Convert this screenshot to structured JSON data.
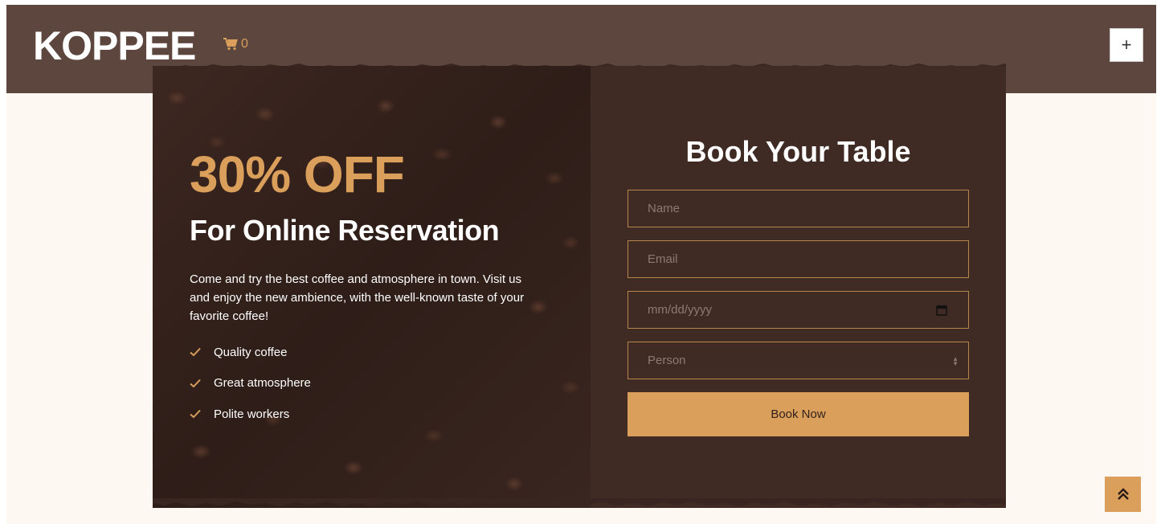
{
  "navbar": {
    "brand": "KOPPEE",
    "cart_count": "0",
    "cart_icon": "shopping-cart-icon",
    "toggler_label": "+"
  },
  "promo": {
    "title": "30% OFF",
    "subtitle": "For Online Reservation",
    "description": "Come and try the best coffee and atmosphere in town. Visit us and enjoy the new ambience, with the well-known taste of your favorite coffee!",
    "features": [
      {
        "label": "Quality coffee",
        "icon": "check-icon"
      },
      {
        "label": "Great atmosphere",
        "icon": "check-icon"
      },
      {
        "label": "Polite workers",
        "icon": "check-icon"
      }
    ]
  },
  "form": {
    "title": "Book Your Table",
    "name_placeholder": "Name",
    "email_placeholder": "Email",
    "date_placeholder": "mm/dd/yyyy",
    "person_placeholder": "Person",
    "submit_label": "Book Now"
  },
  "back_to_top_icon": "double-chevron-up-icon",
  "colors": {
    "accent": "#da9f5b",
    "navbar_bg": "#5c463e",
    "panel_bg": "#3a2621",
    "page_bg": "#fdf8f2"
  }
}
